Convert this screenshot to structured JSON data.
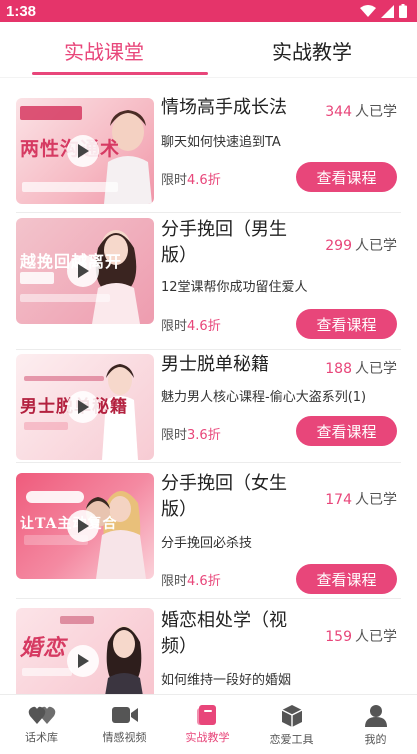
{
  "status_bar": {
    "time": "1:38"
  },
  "tabs": [
    {
      "label": "实战课堂",
      "active": true
    },
    {
      "label": "实战教学",
      "active": false
    }
  ],
  "courses": [
    {
      "title": "情场高手成长法",
      "learners_count": "344",
      "learners_suffix": "人已学",
      "subtitle": "聊天如何快速追到TA",
      "price_prefix": "限时",
      "discount": "4.6折",
      "button": "查看课程",
      "thumb_caption": "两性沟通术",
      "thumb_caption_color": "#d63a62"
    },
    {
      "title": "分手挽回（男生版）",
      "learners_count": "299",
      "learners_suffix": "人已学",
      "subtitle": "12堂课帮你成功留住爱人",
      "price_prefix": "限时",
      "discount": "4.6折",
      "button": "查看课程",
      "thumb_caption": "越挽回越离开",
      "thumb_caption_color": "#ffffff"
    },
    {
      "title": "男士脱单秘籍",
      "learners_count": "188",
      "learners_suffix": "人已学",
      "subtitle": "魅力男人核心课程-偷心大盗系列(1)",
      "price_prefix": "限时",
      "discount": "3.6折",
      "button": "查看课程",
      "thumb_caption": "男士脱单秘籍",
      "thumb_caption_color": "#b3213f"
    },
    {
      "title": "分手挽回（女生版）",
      "learners_count": "174",
      "learners_suffix": "人已学",
      "subtitle": "分手挽回必杀技",
      "price_prefix": "限时",
      "discount": "4.6折",
      "button": "查看课程",
      "thumb_caption": "让TA主动复合",
      "thumb_caption_color": "#ffffff"
    },
    {
      "title": "婚恋相处学（视频）",
      "learners_count": "159",
      "learners_suffix": "人已学",
      "subtitle": "如何维持一段好的婚姻",
      "price_prefix": "",
      "discount": "",
      "button": "",
      "thumb_caption": "婚恋",
      "thumb_caption_color": "#d63a62"
    }
  ],
  "bottom_nav": [
    {
      "label": "话术库",
      "icon": "hearts-icon",
      "active": false
    },
    {
      "label": "情感视频",
      "icon": "video-camera-icon",
      "active": false
    },
    {
      "label": "实战教学",
      "icon": "book-icon",
      "active": true
    },
    {
      "label": "恋爱工具",
      "icon": "cube-icon",
      "active": false
    },
    {
      "label": "我的",
      "icon": "person-icon",
      "active": false
    }
  ],
  "colors": {
    "accent": "#e8467a",
    "status_bar": "#e5346a",
    "inactive_icon": "#555555"
  }
}
